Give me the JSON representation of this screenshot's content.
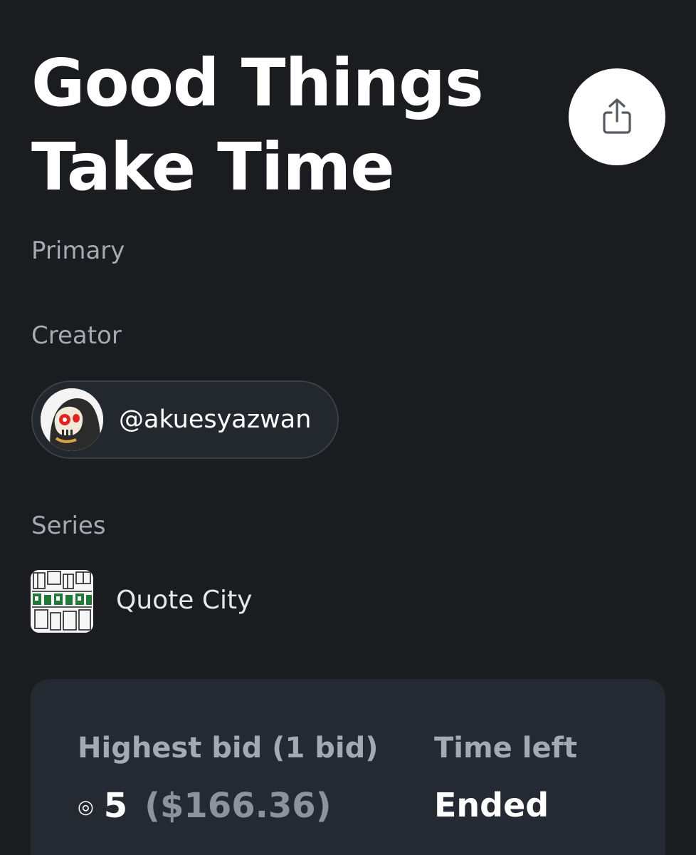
{
  "item": {
    "title_line1": "Good Things",
    "title_line2": "Take Time",
    "sale_type": "Primary"
  },
  "creator": {
    "label": "Creator",
    "handle": "@akuesyazwan",
    "avatar_icon": "skull-hood-avatar"
  },
  "series": {
    "label": "Series",
    "name": "Quote City",
    "thumbnail_icon": "city-illustration-thumbnail"
  },
  "share": {
    "icon": "share-icon"
  },
  "auction": {
    "bid_label": "Highest bid (1 bid)",
    "currency_icon": "◎",
    "bid_amount": "5",
    "bid_usd": "($166.36)",
    "time_label": "Time left",
    "time_value": "Ended"
  },
  "colors": {
    "background": "#1b1c20",
    "card": "#252931",
    "muted_text": "#a4a9b2",
    "usd_text": "#8d929b",
    "avatar_accent": "#e02424",
    "series_accent": "#1f7a3a"
  }
}
